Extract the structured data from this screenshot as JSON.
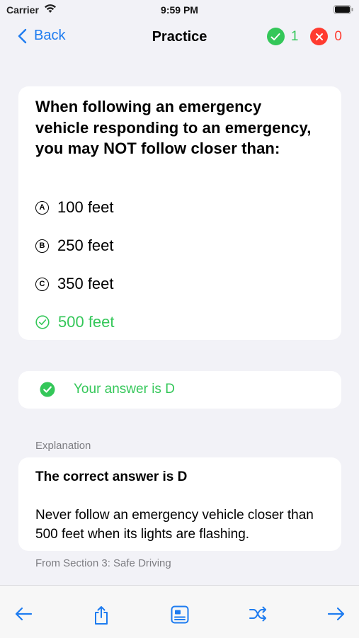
{
  "status_bar": {
    "carrier": "Carrier",
    "time": "9:59 PM"
  },
  "nav": {
    "back_label": "Back",
    "title": "Practice",
    "correct_count": "1",
    "wrong_count": "0"
  },
  "colors": {
    "accent": "#1e7cf0",
    "correct": "#34c759",
    "wrong": "#ff3b30"
  },
  "question": {
    "text": "When following an emergency vehicle responding to an emergency, you may NOT follow closer than:",
    "options": [
      {
        "letter": "A",
        "text": "100 feet",
        "state": "default"
      },
      {
        "letter": "B",
        "text": "250 feet",
        "state": "default"
      },
      {
        "letter": "C",
        "text": "350 feet",
        "state": "default"
      },
      {
        "letter": "D",
        "text": "500 feet",
        "state": "correct"
      }
    ]
  },
  "result": {
    "text": "Your answer is D",
    "icon": "checkmark-circle-filled-icon"
  },
  "explanation": {
    "label": "Explanation",
    "title": "The correct answer is D",
    "body": "Never follow an emergency vehicle closer than 500 feet when its lights are flashing.",
    "source": "From Section 3: Safe Driving"
  },
  "toolbar": {
    "icons": [
      "arrow-left-icon",
      "share-icon",
      "flashcard-icon",
      "shuffle-icon",
      "arrow-right-icon"
    ]
  }
}
